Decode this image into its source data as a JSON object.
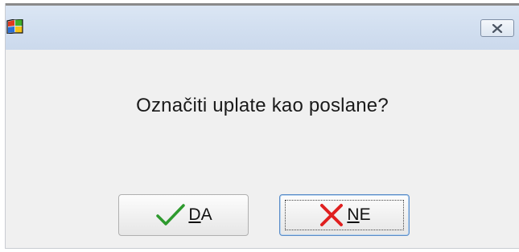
{
  "window": {
    "icon": "windows-flag-icon",
    "close_icon": "close-icon"
  },
  "message": "Označiti uplate kao poslane?",
  "buttons": {
    "yes": {
      "mnemonic": "D",
      "rest": "A",
      "icon": "checkmark-icon",
      "icon_color": "#2e9a2e"
    },
    "no": {
      "mnemonic": "N",
      "rest": "E",
      "icon": "cross-icon",
      "icon_color": "#e02020"
    }
  }
}
